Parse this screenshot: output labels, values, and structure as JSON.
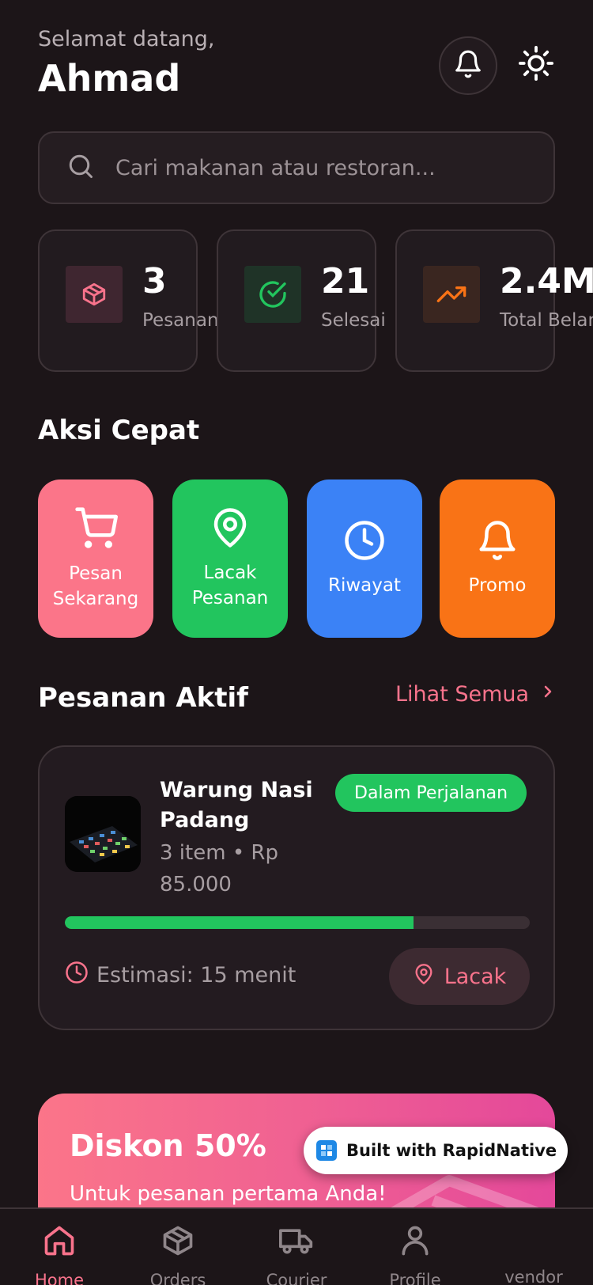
{
  "header": {
    "greeting": "Selamat datang,",
    "username": "Ahmad"
  },
  "search": {
    "placeholder": "Cari makanan atau restoran..."
  },
  "stats": [
    {
      "value": "3",
      "label": "Pesanan",
      "icon": "package-icon",
      "color": "#f9738c"
    },
    {
      "value": "21",
      "label": "Selesai",
      "icon": "check-circle-icon",
      "color": "#22c55e"
    },
    {
      "value": "2.4M",
      "label": "Total Belanja",
      "icon": "trending-up-icon",
      "color": "#f97316"
    }
  ],
  "quick_actions": {
    "title": "Aksi Cepat",
    "items": [
      {
        "label": "Pesan\nSekarang",
        "icon": "cart-icon",
        "color": "#fb7589"
      },
      {
        "label": "Lacak\nPesanan",
        "icon": "map-pin-icon",
        "color": "#22c55e"
      },
      {
        "label": "Riwayat",
        "icon": "clock-icon",
        "color": "#3b82f6"
      },
      {
        "label": "Promo",
        "icon": "bell-icon",
        "color": "#f97316"
      }
    ]
  },
  "active_orders": {
    "title": "Pesanan Aktif",
    "see_all": "Lihat Semua",
    "order": {
      "restaurant": "Warung Nasi Padang",
      "detail": "3 item • Rp 85.000",
      "status": "Dalam Perjalanan",
      "progress": 0.75,
      "eta": "Estimasi: 15 menit",
      "track_label": "Lacak"
    }
  },
  "promo": {
    "title": "Diskon 50%",
    "subtitle": "Untuk pesanan pertama Anda!"
  },
  "badge": {
    "label": "Built with RapidNative"
  },
  "nav": {
    "items": [
      {
        "label": "Home",
        "icon": "home-icon",
        "active": true
      },
      {
        "label": "Orders",
        "icon": "package-icon",
        "active": false
      },
      {
        "label": "Courier",
        "icon": "truck-icon",
        "active": false
      },
      {
        "label": "Profile",
        "icon": "user-icon",
        "active": false
      },
      {
        "label": "vendor",
        "icon": "store-icon",
        "active": false
      }
    ]
  },
  "colors": {
    "accent": "#f9738c",
    "success": "#22c55e",
    "background": "#1c1518"
  }
}
